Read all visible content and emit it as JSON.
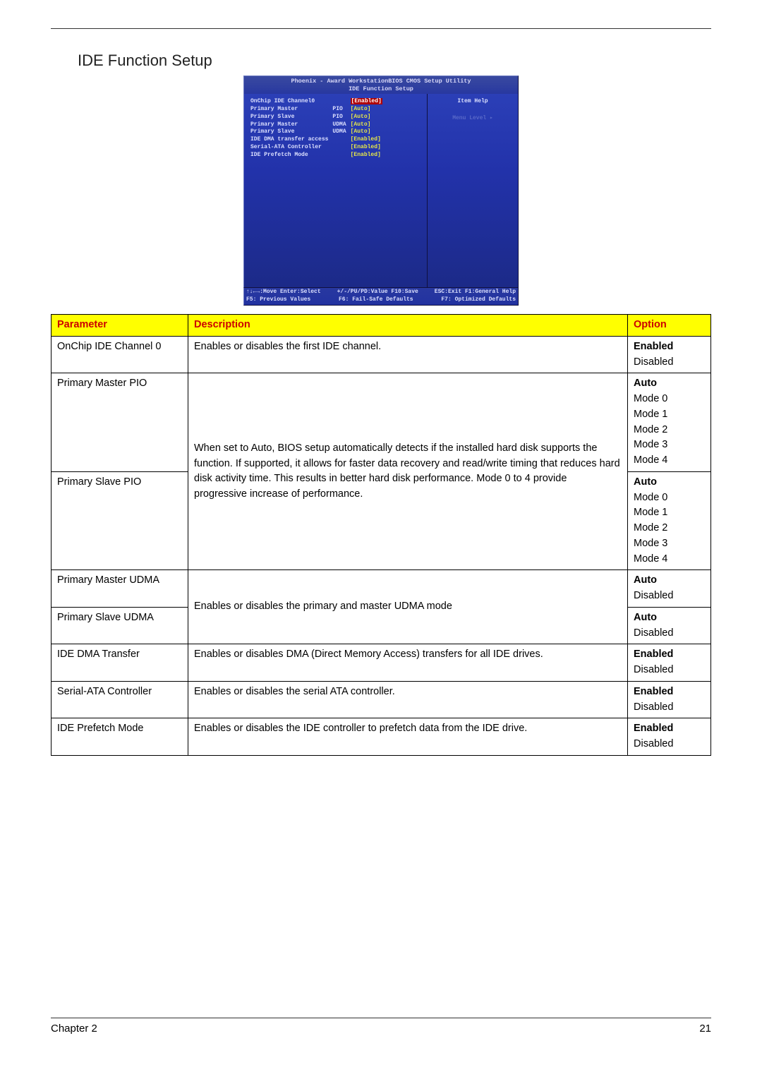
{
  "section_title": "IDE Function Setup",
  "bios": {
    "title_line1": "Phoenix - Award WorkstationBIOS CMOS Setup Utility",
    "title_line2": "IDE Function Setup",
    "rows": [
      {
        "label": "OnChip IDE Channel0",
        "col2": "",
        "value": "[Enabled]",
        "selected": true
      },
      {
        "label": "Primary Master",
        "col2": "PIO",
        "value": "[Auto]"
      },
      {
        "label": "Primary Slave",
        "col2": "PIO",
        "value": "[Auto]"
      },
      {
        "label": "Primary Master",
        "col2": "UDMA",
        "value": "[Auto]"
      },
      {
        "label": "Primary Slave",
        "col2": "UDMA",
        "value": "[Auto]"
      },
      {
        "label": "IDE DMA transfer access",
        "col2": "",
        "value": "[Enabled]"
      },
      {
        "label": "Serial-ATA Controller",
        "col2": "",
        "value": "[Enabled]"
      },
      {
        "label": "IDE Prefetch Mode",
        "col2": "",
        "value": "[Enabled]"
      }
    ],
    "help_header": "Item Help",
    "menu_level": "Menu Level  ▸",
    "footer1_a": "↑↓←→:Move  Enter:Select",
    "footer1_b": "+/-/PU/PD:Value  F10:Save",
    "footer1_c": "ESC:Exit  F1:General Help",
    "footer2_a": "F5: Previous Values",
    "footer2_b": "F6: Fail-Safe Defaults",
    "footer2_c": "F7: Optimized Defaults"
  },
  "table": {
    "headers": {
      "param": "Parameter",
      "desc": "Description",
      "opt": "Option"
    },
    "rows": [
      {
        "param": "OnChip IDE Channel 0",
        "desc": "Enables or disables the first IDE channel.",
        "opts": [
          "Enabled",
          "Disabled"
        ]
      },
      {
        "param": "Primary Master PIO",
        "desc_group": "pio",
        "opts": [
          "Auto",
          "Mode 0",
          "Mode 1",
          "Mode 2",
          "Mode 3",
          "Mode 4"
        ]
      },
      {
        "param": "Primary Slave PIO",
        "desc_group": "pio",
        "opts": [
          "Auto",
          "Mode 0",
          "Mode 1",
          "Mode 2",
          "Mode 3",
          "Mode 4"
        ]
      },
      {
        "param": "Primary Master UDMA",
        "desc_group": "udma",
        "opts": [
          "Auto",
          "Disabled"
        ]
      },
      {
        "param": "Primary Slave UDMA",
        "desc_group": "udma",
        "opts": [
          "Auto",
          "Disabled"
        ]
      },
      {
        "param": "IDE DMA Transfer",
        "desc": "Enables or disables DMA (Direct Memory Access) transfers for all IDE drives.",
        "opts": [
          "Enabled",
          "Disabled"
        ]
      },
      {
        "param": "Serial-ATA Controller",
        "desc": "Enables or disables the serial ATA controller.",
        "opts": [
          "Enabled",
          "Disabled"
        ]
      },
      {
        "param": "IDE Prefetch Mode",
        "desc": "Enables or disables the IDE controller to prefetch data from the IDE drive.",
        "opts": [
          "Enabled",
          "Disabled"
        ]
      }
    ],
    "desc_pio": "When set to Auto, BIOS setup automatically detects if the installed hard disk supports the function. If supported, it allows for faster data recovery and read/write timing that reduces hard disk activity time. This results in better hard disk performance. Mode 0 to 4 provide progressive increase of performance.",
    "desc_udma": "Enables or disables the primary and master UDMA mode"
  },
  "footer": {
    "chapter": "Chapter 2",
    "page": "21"
  }
}
